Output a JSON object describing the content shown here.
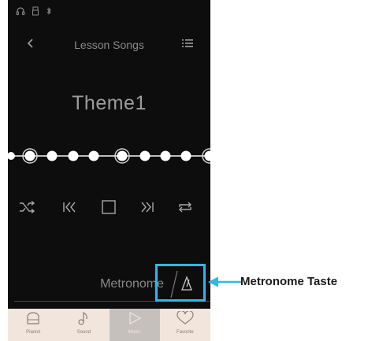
{
  "status_bar": {
    "icons": [
      "headphones-icon",
      "usb-icon",
      "bluetooth-icon"
    ]
  },
  "header": {
    "title": "Lesson Songs",
    "back_icon": "chevron-left-icon",
    "list_icon": "list-icon"
  },
  "song": {
    "title": "Theme1"
  },
  "controls": {
    "items": [
      "shuffle-icon",
      "skip-back-icon",
      "stop-icon",
      "skip-forward-icon",
      "repeat-icon"
    ]
  },
  "metronome": {
    "label": "Metronome",
    "icon": "metronome-icon"
  },
  "tabs": [
    {
      "label": "Pianist",
      "icon": "piano-icon",
      "active": false
    },
    {
      "label": "Sound",
      "icon": "music-note-icon",
      "active": false
    },
    {
      "label": "Music",
      "icon": "play-icon",
      "active": true
    },
    {
      "label": "Favorite",
      "icon": "heart-icon",
      "active": false
    }
  ],
  "annotation": {
    "label": "Metronome Taste",
    "color": "#2fb7ea"
  },
  "colors": {
    "background": "#0d0d0d",
    "text_dim": "#8a8a8a",
    "tab_bar": "#f2e6dc",
    "accent": "#2fb7ea"
  }
}
